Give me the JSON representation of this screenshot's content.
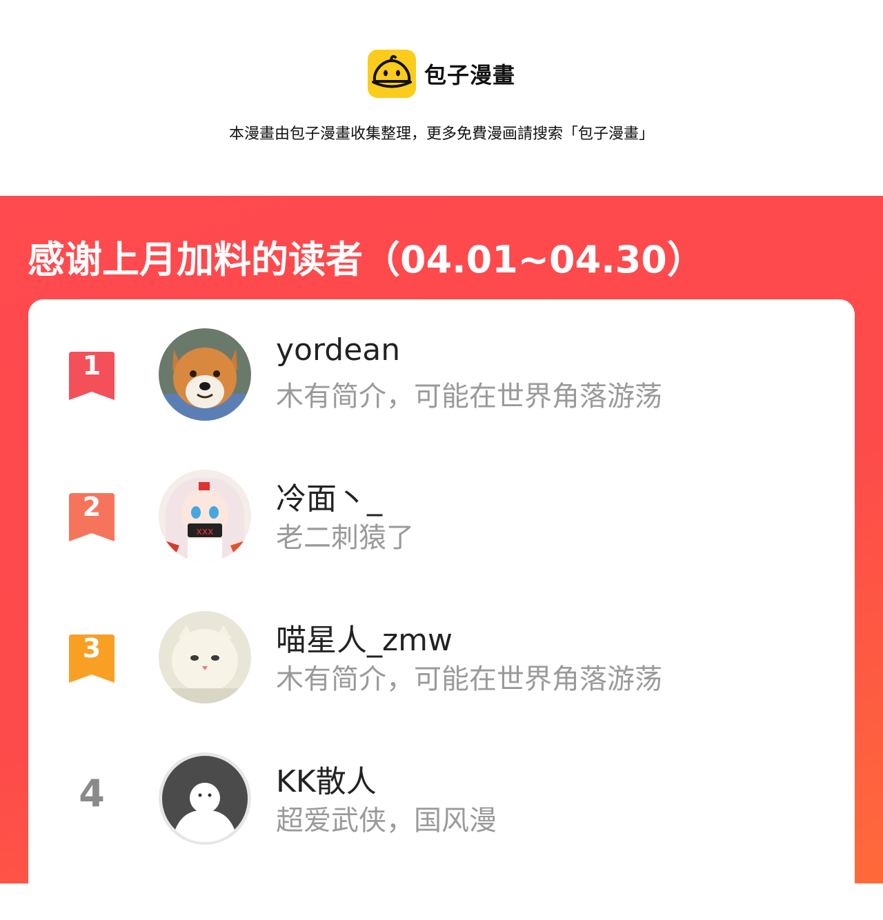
{
  "brand": {
    "name": "包子漫畫",
    "tagline": "本漫畫由包子漫畫收集整理，更多免費漫画請搜索「包子漫畫」",
    "logo_color": "#fccc1c"
  },
  "panel": {
    "title": "感谢上月加料的读者（04.01~04.30）",
    "background_color": "#fd4a4a"
  },
  "readers": [
    {
      "rank": "1",
      "name": "yordean",
      "bio": "木有简介，可能在世界角落游荡",
      "badge_color": "#f3505a",
      "avatar": "shiba-dog-photo"
    },
    {
      "rank": "2",
      "name": "冷面丶_",
      "bio": "老二刺猿了",
      "badge_color": "#f7745c",
      "avatar": "anime-girl-illustration"
    },
    {
      "rank": "3",
      "name": "喵星人_zmw",
      "bio": "木有简介，可能在世界角落游荡",
      "badge_color": "#f9a024",
      "avatar": "white-kitten-photo"
    },
    {
      "rank": "4",
      "name": "KK散人",
      "bio": "超爱武侠，国风漫",
      "avatar": "default-user-avatar"
    }
  ]
}
